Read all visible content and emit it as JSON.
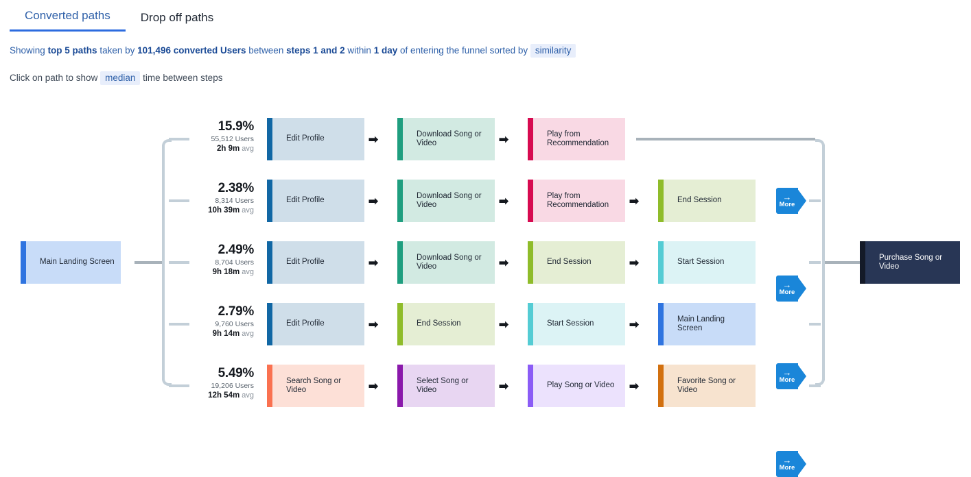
{
  "tabs": [
    {
      "label": "Converted paths",
      "active": true
    },
    {
      "label": "Drop off paths",
      "active": false
    }
  ],
  "description": {
    "showing": "Showing",
    "top_paths": "top 5 paths",
    "taken_by": "taken by",
    "users": "101,496 converted Users",
    "between": "between",
    "steps": "steps 1 and 2",
    "within": "within",
    "duration": "1 day",
    "of_entering": "of entering the funnel sorted by",
    "sort_chip": "similarity"
  },
  "subdescription": {
    "prefix": "Click on path to show",
    "chip": "median",
    "suffix": "time between steps"
  },
  "start_node": {
    "label": "Main Landing Screen",
    "bar": "#2f74e0",
    "bg": "#c8dcf8"
  },
  "end_node": {
    "label": "Purchase Song or Video",
    "bar": "#141a28",
    "bg": "#283655"
  },
  "more_button": {
    "label": "More",
    "arrow": "→",
    "color": "#1a86d9"
  },
  "step_arrow": "➡",
  "chart_data": {
    "type": "sankey-paths",
    "title": "Converted paths",
    "total_users": 101496,
    "paths": [
      {
        "percent": "15.9%",
        "users": "55,512 Users",
        "avg_time": "2h 9m",
        "avg_suffix": "avg",
        "has_more": false,
        "steps": [
          {
            "label": "Edit Profile",
            "bar": "#1167a4",
            "bg": "#cfdee9"
          },
          {
            "label": "Download Song or Video",
            "bar": "#1f9e7f",
            "bg": "#d2eae2"
          },
          {
            "label": "Play from Recommendation",
            "bar": "#d70a50",
            "bg": "#f9d9e4"
          }
        ]
      },
      {
        "percent": "2.38%",
        "users": "8,314 Users",
        "avg_time": "10h 39m",
        "avg_suffix": "avg",
        "has_more": true,
        "steps": [
          {
            "label": "Edit Profile",
            "bar": "#1167a4",
            "bg": "#cfdee9"
          },
          {
            "label": "Download Song or Video",
            "bar": "#1f9e7f",
            "bg": "#d2eae2"
          },
          {
            "label": "Play from Recommendation",
            "bar": "#d70a50",
            "bg": "#f9d9e4"
          },
          {
            "label": "End Session",
            "bar": "#8fbc2a",
            "bg": "#e5eed4"
          }
        ]
      },
      {
        "percent": "2.49%",
        "users": "8,704 Users",
        "avg_time": "9h 18m",
        "avg_suffix": "avg",
        "has_more": true,
        "steps": [
          {
            "label": "Edit Profile",
            "bar": "#1167a4",
            "bg": "#cfdee9"
          },
          {
            "label": "Download Song or Video",
            "bar": "#1f9e7f",
            "bg": "#d2eae2"
          },
          {
            "label": "End Session",
            "bar": "#8fbc2a",
            "bg": "#e5eed4"
          },
          {
            "label": "Start Session",
            "bar": "#54ccd4",
            "bg": "#dcf3f5"
          }
        ]
      },
      {
        "percent": "2.79%",
        "users": "9,760 Users",
        "avg_time": "9h 14m",
        "avg_suffix": "avg",
        "has_more": true,
        "steps": [
          {
            "label": "Edit Profile",
            "bar": "#1167a4",
            "bg": "#cfdee9"
          },
          {
            "label": "End Session",
            "bar": "#8fbc2a",
            "bg": "#e5eed4"
          },
          {
            "label": "Start Session",
            "bar": "#54ccd4",
            "bg": "#dcf3f5"
          },
          {
            "label": "Main Landing Screen",
            "bar": "#2f74e0",
            "bg": "#c8dcf8"
          }
        ]
      },
      {
        "percent": "5.49%",
        "users": "19,206 Users",
        "avg_time": "12h 54m",
        "avg_suffix": "avg",
        "has_more": true,
        "steps": [
          {
            "label": "Search Song or Video",
            "bar": "#fa7150",
            "bg": "#fde0d7"
          },
          {
            "label": "Select Song or Video",
            "bar": "#8a19ab",
            "bg": "#e8d6f2"
          },
          {
            "label": "Play Song or Video",
            "bar": "#8b5cf6",
            "bg": "#ece2fd"
          },
          {
            "label": "Favorite Song or Video",
            "bar": "#d2700f",
            "bg": "#f7e3cf"
          }
        ]
      }
    ]
  }
}
